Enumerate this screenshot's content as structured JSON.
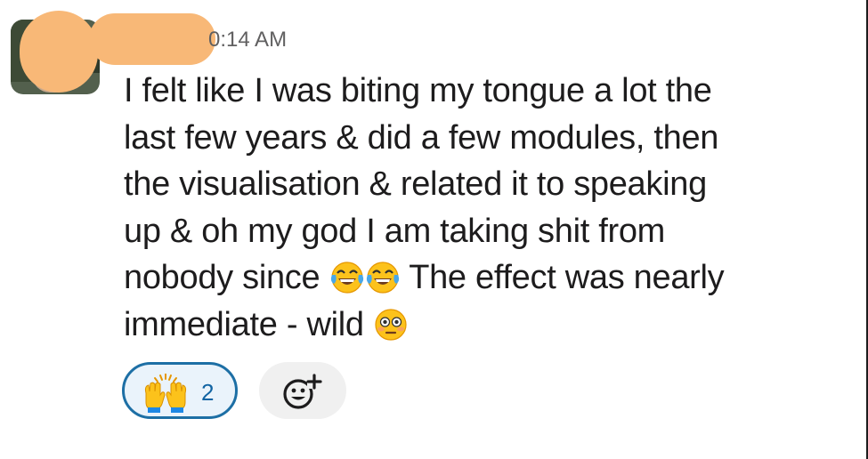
{
  "message": {
    "timestamp": "0:14 AM",
    "lines": [
      "I felt like I was biting my tongue a lot the",
      "last few years & did a few modules, then",
      "the visualisation & related it to speaking",
      "up & oh my god I am taking shit from",
      "nobody since",
      "The effect was nearly",
      "immediate - wild"
    ],
    "emojis": [
      "face-with-tears-of-joy-icon",
      "face-with-tears-of-joy-icon",
      "flushed-face-icon"
    ]
  },
  "reactions": [
    {
      "icon": "raising-hands-icon",
      "count": "2",
      "selected": true
    }
  ],
  "add_reaction": {
    "icon": "add-reaction-icon"
  },
  "colors": {
    "reaction_border": "#1d6fa5",
    "reaction_bg": "#eaf3fb",
    "text": "#1d1c1d",
    "timestamp": "#616061",
    "redaction": "#f8b877"
  }
}
